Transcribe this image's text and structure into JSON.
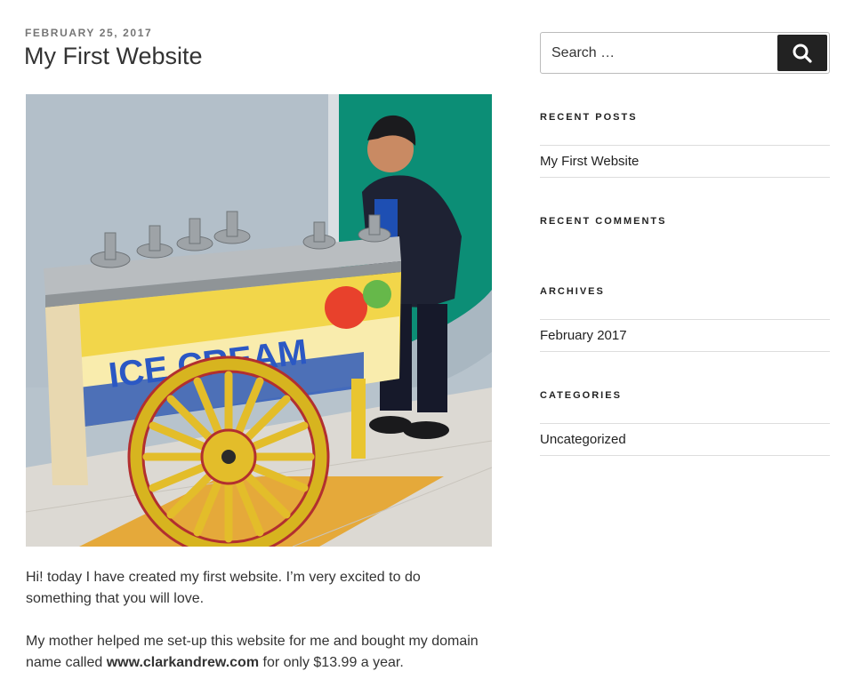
{
  "post": {
    "date": "FEBRUARY 25, 2017",
    "title": "My First Website",
    "image": {
      "cart_lettering": "ICE CREAM"
    },
    "paragraphs": [
      "Hi! today I have created my first website. I’m very excited to do something that you will love.",
      {
        "before": "My mother helped me set-up this website for me and bought my domain name called ",
        "bold": "www.clarkandrew.com",
        "after": " for only $13.99 a year."
      }
    ]
  },
  "sidebar": {
    "search": {
      "placeholder": "Search …",
      "button_icon": "search-icon"
    },
    "widgets": {
      "recent_posts": {
        "title": "RECENT POSTS",
        "items": [
          "My First Website"
        ]
      },
      "recent_comments": {
        "title": "RECENT COMMENTS",
        "items": []
      },
      "archives": {
        "title": "ARCHIVES",
        "items": [
          "February 2017"
        ]
      },
      "categories": {
        "title": "CATEGORIES",
        "items": [
          "Uncategorized"
        ]
      }
    }
  },
  "colors": {
    "text": "#333333",
    "meta": "#767676",
    "button": "#222222",
    "divider": "#dddddd"
  }
}
